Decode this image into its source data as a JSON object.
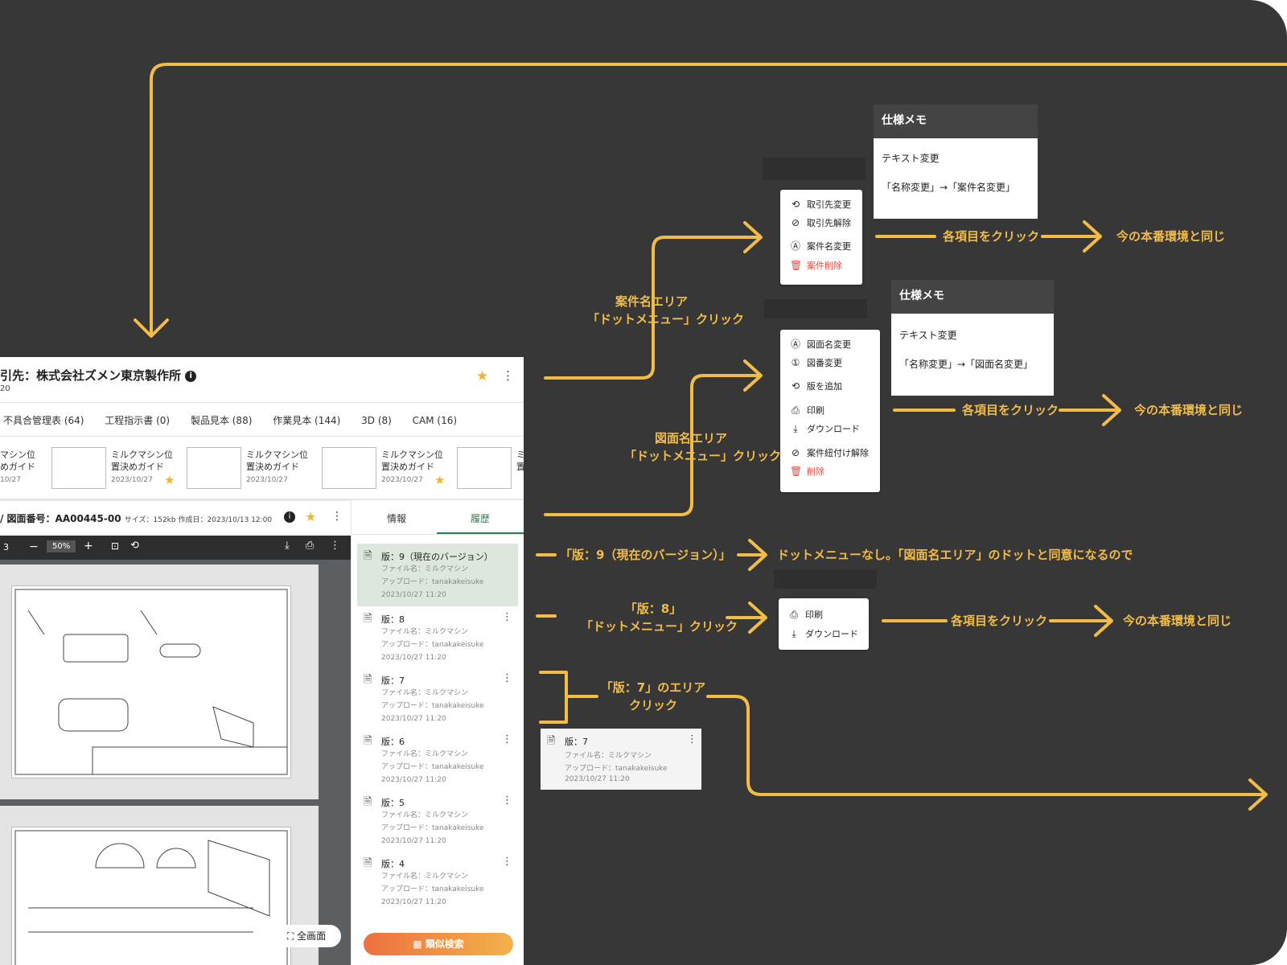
{
  "colors": {
    "background": "#373737",
    "accent": "#f1bc48",
    "danger": "#e5493b",
    "tab_active": "#2e7d4f",
    "version_highlight": "#dde7dd"
  },
  "app": {
    "client_title": "引先：株式会社ズメン東京製作所",
    "client_sub": "20",
    "tabs": [
      "不具合管理表 (64)",
      "工程指示書 (0)",
      "製品見本 (88)",
      "作業見本 (144)",
      "3D (8)",
      "CAM (16)"
    ],
    "thumbs": [
      {
        "line1": "マシン位",
        "line2": "めガイド",
        "date": "10/27"
      },
      {
        "line1": "ミルクマシン位",
        "line2": "置決めガイド",
        "date": "2023/10/27",
        "starred": true
      },
      {
        "line1": "ミルクマシン位",
        "line2": "置決めガイド",
        "date": "2023/10/27"
      },
      {
        "line1": "ミルクマシン位",
        "line2": "置決めガイド",
        "date": "2023/10/27",
        "starred": true
      },
      {
        "line1": "ミ",
        "line2": "置",
        "date": "20"
      }
    ],
    "drawing_header": {
      "label": "/ 図面番号：AA00445-00",
      "meta": "サイズ：152kb 作成日：2023/10/13 12:00"
    },
    "viewer": {
      "page": "3",
      "zoom": "50%"
    },
    "side_tabs": [
      "情報",
      "履歴"
    ],
    "history": [
      {
        "title": "版：9（現在のバージョン）",
        "file": "ファイル名：ミルクマシン",
        "upload": "アップロード：tanakakeisuke",
        "date": "2023/10/27 11:20",
        "current": true
      },
      {
        "title": "版：8",
        "file": "ファイル名：ミルクマシン",
        "upload": "アップロード：tanakakeisuke",
        "date": "2023/10/27 11:20"
      },
      {
        "title": "版：7",
        "file": "ファイル名：ミルクマシン",
        "upload": "アップロード：tanakakeisuke",
        "date": "2023/10/27 11:20"
      },
      {
        "title": "版：6",
        "file": "ファイル名：ミルクマシン",
        "upload": "アップロード：tanakakeisuke",
        "date": "2023/10/27 11:20"
      },
      {
        "title": "版：5",
        "file": "ファイル名：ミルクマシン",
        "upload": "アップロード：tanakakeisuke",
        "date": "2023/10/27 11:20"
      },
      {
        "title": "版：4",
        "file": "ファイル名：ミルクマシン",
        "upload": "アップロード：tanakakeisuke",
        "date": "2023/10/27 11:20"
      }
    ],
    "fullscreen": "全画面",
    "similar_search": "類似検索"
  },
  "labels": {
    "case_area": "案件名エリア",
    "drawing_area": "図面名エリア",
    "dot_click": "「ドットメニュー」クリック",
    "v9": "「版：9（現在のバージョン）」",
    "v9_note": "ドットメニューなし。「図面名エリア」のドットと同意になるので",
    "v8": "「版：8」",
    "v7_1": "「版：7」のエリア",
    "v7_2": "クリック",
    "each_click": "各項目をクリック",
    "same_as_prod": "今の本番環境と同じ"
  },
  "menus": {
    "case": [
      "取引先変更",
      "取引先解除",
      "案件名変更",
      "案件削除"
    ],
    "drawing": [
      "図面名変更",
      "図番変更",
      "版を追加",
      "印刷",
      "ダウンロード",
      "案件紐付け解除",
      "削除"
    ],
    "version": [
      "印刷",
      "ダウンロード"
    ]
  },
  "memos": [
    {
      "title": "仕様メモ",
      "line1": "テキスト変更",
      "line2": "「名称変更」→「案件名変更」"
    },
    {
      "title": "仕様メモ",
      "line1": "テキスト変更",
      "line2": "「名称変更」→「図面名変更」"
    }
  ],
  "card_v7": {
    "title": "版：7",
    "file": "ファイル名：ミルクマシン",
    "upload": "アップロード：tanakakeisuke",
    "date": "2023/10/27 11:20"
  }
}
